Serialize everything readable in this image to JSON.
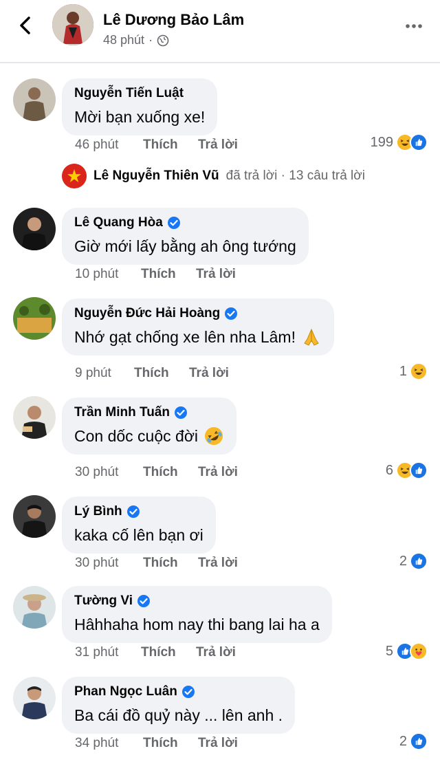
{
  "header": {
    "name": "Lê Dương Bảo Lâm",
    "time": "48 phút",
    "separator": "·"
  },
  "actions": {
    "like": "Thích",
    "reply": "Trả lời"
  },
  "reply_summary": {
    "name": "Lê Nguyễn Thiên Vũ",
    "text": "đã trả lời · 13 câu trả lời"
  },
  "comments": [
    {
      "author": "Nguyễn Tiến Luật",
      "text": "Mời bạn xuống xe!",
      "time": "46 phút",
      "reaction_count": "199",
      "verified": false
    },
    {
      "author": "Lê Quang Hòa",
      "text": "Giờ mới lấy bằng ah ông tướng",
      "time": "10 phút",
      "reaction_count": "",
      "verified": true
    },
    {
      "author": "Nguyễn Đức Hải Hoàng",
      "text": "Nhớ gạt chống xe lên nha Lâm!",
      "time": "9 phút",
      "reaction_count": "1",
      "verified": true
    },
    {
      "author": "Trần Minh Tuấn",
      "text": "Con dốc cuộc đời",
      "time": "30 phút",
      "reaction_count": "6",
      "verified": true
    },
    {
      "author": "Lý Bình",
      "text": "kaka cố lên bạn ơi",
      "time": "30 phút",
      "reaction_count": "2",
      "verified": true
    },
    {
      "author": "Tường Vi",
      "text": "Hâhhaha hom nay thi bang lai ha a",
      "time": "31 phút",
      "reaction_count": "5",
      "verified": true
    },
    {
      "author": "Phan Ngọc Luân",
      "text": "Ba cái đồ quỷ này ... lên anh .",
      "time": "34 phút",
      "reaction_count": "2",
      "verified": true
    }
  ],
  "colors": {
    "like_blue": "#1b74e4",
    "haha_yellow": "#f7b928",
    "verified_blue": "#1877f2",
    "bubble_bg": "#f0f2f5",
    "secondary_text": "#65676b"
  },
  "icons": {
    "back": "chevron-left-icon",
    "more": "more-dots-icon",
    "globe": "globe-icon",
    "verified": "verified-badge-icon",
    "like": "like-reaction-icon",
    "haha": "haha-reaction-icon",
    "care": "care-reaction-icon",
    "pray": "folded-hands-emoji",
    "rofl": "rolling-laughing-emoji",
    "flag": "vietnam-flag-icon"
  }
}
